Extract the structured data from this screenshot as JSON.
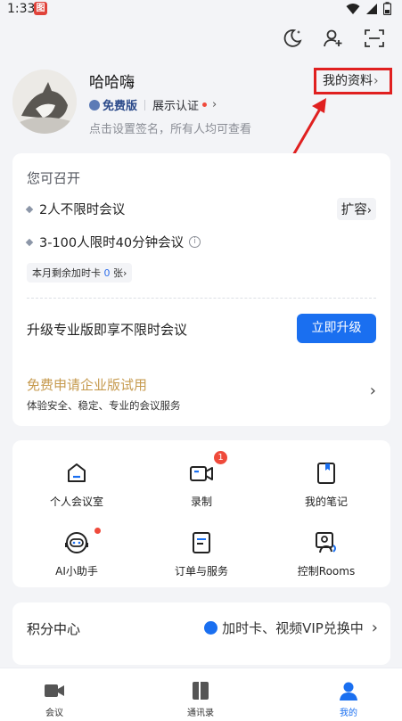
{
  "status_bar": {
    "time": "1:33",
    "app_icon_text": "图"
  },
  "profile": {
    "name": "哈哈嗨",
    "plan": "免费版",
    "verify": "展示认证",
    "signature": "点击设置签名，所有人均可查看",
    "my_profile": "我的资料"
  },
  "host_card": {
    "title": "您可召开",
    "feature1": "2人不限时会议",
    "feature2": "3-100人限时40分钟会议",
    "expand": "扩容",
    "tag_prefix": "本月剩余加时卡",
    "tag_num": "0",
    "tag_suffix": "张",
    "upgrade_text": "升级专业版即享不限时会议",
    "upgrade_btn": "立即升级"
  },
  "trial_card": {
    "title": "免费申请企业版试用",
    "subtitle": "体验安全、稳定、专业的会议服务"
  },
  "grid": {
    "personal_room": "个人会议室",
    "recording": "录制",
    "recording_badge": "1",
    "notes": "我的笔记",
    "ai_assistant": "AI小助手",
    "orders": "订单与服务",
    "rooms": "控制Rooms"
  },
  "points_card": {
    "title": "积分中心",
    "promo": "加时卡、视频VIP兑换中"
  },
  "bottom_nav": {
    "meeting": "会议",
    "contacts": "通讯录",
    "mine": "我的"
  },
  "colors": {
    "accent": "#1a6ff0",
    "gold": "#c69a4e",
    "highlight_box": "#e02020",
    "badge_red": "#ef4a3b"
  }
}
